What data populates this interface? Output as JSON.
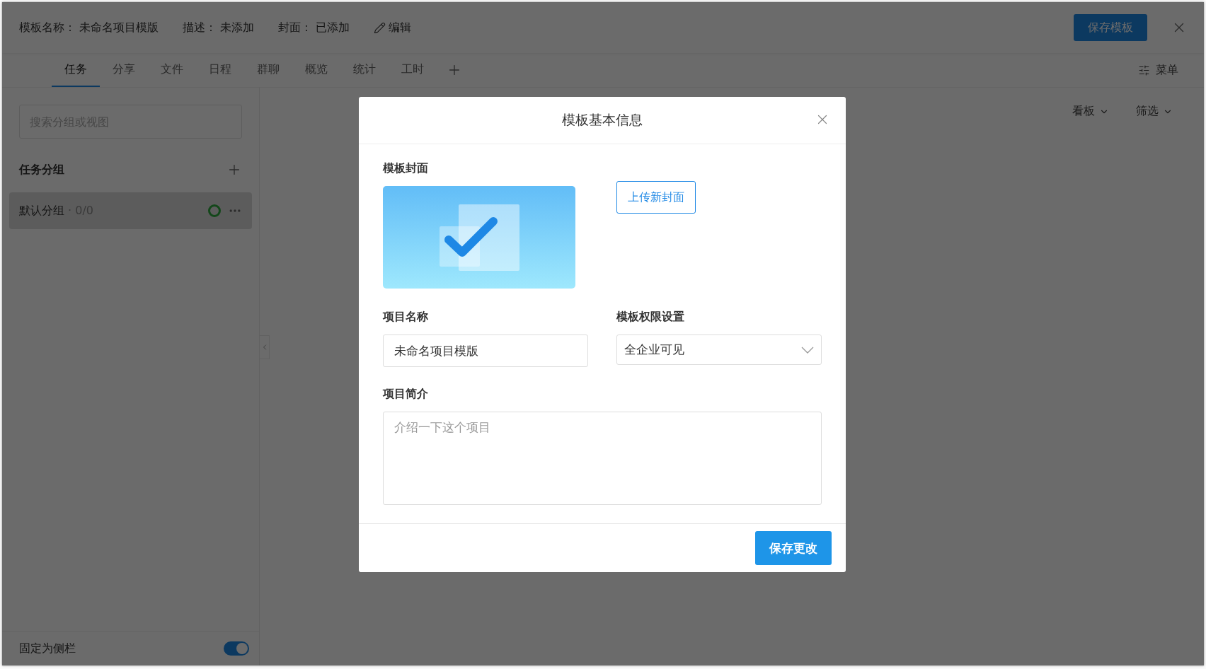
{
  "header": {
    "fields": [
      {
        "label": "模板名称：",
        "value": "未命名项目模版"
      },
      {
        "label": "描述：",
        "value": "未添加"
      },
      {
        "label": "封面：",
        "value": "已添加"
      }
    ],
    "edit_link": "编辑",
    "save_button": "保存模板"
  },
  "tabs": [
    {
      "label": "任务",
      "selected": true
    },
    {
      "label": "分享",
      "selected": false
    },
    {
      "label": "文件",
      "selected": false
    },
    {
      "label": "日程",
      "selected": false
    },
    {
      "label": "群聊",
      "selected": false
    },
    {
      "label": "概览",
      "selected": false
    },
    {
      "label": "统计",
      "selected": false
    },
    {
      "label": "工时",
      "selected": false
    }
  ],
  "menu_button": "菜单",
  "sidebar": {
    "search": {
      "placeholder": "搜索分组或视图"
    },
    "section_title": "任务分组",
    "groups": [
      {
        "name": "默认分组",
        "count": "· 0/0",
        "selected": true
      }
    ],
    "pin": {
      "label": "固定为侧栏",
      "on": true
    }
  },
  "view_controls": [
    {
      "label": "看板"
    },
    {
      "label": "筛选"
    }
  ],
  "dialog": {
    "title": "模板基本信息",
    "cover_label": "模板封面",
    "upload_button": "上传新封面",
    "name_label": "项目名称",
    "name_value": "未命名项目模版",
    "permission_label": "模板权限设置",
    "permission_value": "全企业可见",
    "intro_label": "项目简介",
    "intro": {
      "placeholder": "介绍一下这个项目"
    },
    "save_button": "保存更改"
  }
}
